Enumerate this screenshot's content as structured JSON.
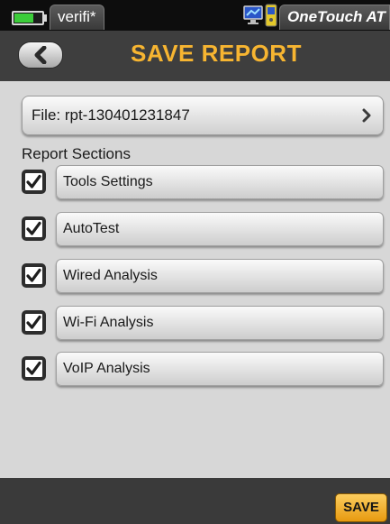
{
  "status_bar": {
    "battery_level": 0.7,
    "battery_color": "#3ccd3a",
    "profile_name": "verifi*",
    "device_name": "OneTouch AT",
    "icons": [
      "monitor-icon",
      "device-icon"
    ]
  },
  "header": {
    "back_icon": "chevron-left-icon",
    "title": "SAVE REPORT",
    "title_color": "#f7b531"
  },
  "file": {
    "label": "File: rpt-130401231847",
    "icon": "chevron-right-icon"
  },
  "report_sections": {
    "heading": "Report Sections",
    "items": [
      {
        "label": "Tools Settings",
        "checked": true
      },
      {
        "label": "AutoTest",
        "checked": true
      },
      {
        "label": "Wired Analysis",
        "checked": true
      },
      {
        "label": "Wi-Fi Analysis",
        "checked": true
      },
      {
        "label": "VoIP Analysis",
        "checked": true
      }
    ]
  },
  "footer": {
    "save_label": "SAVE",
    "save_color": "#f5b02a"
  }
}
